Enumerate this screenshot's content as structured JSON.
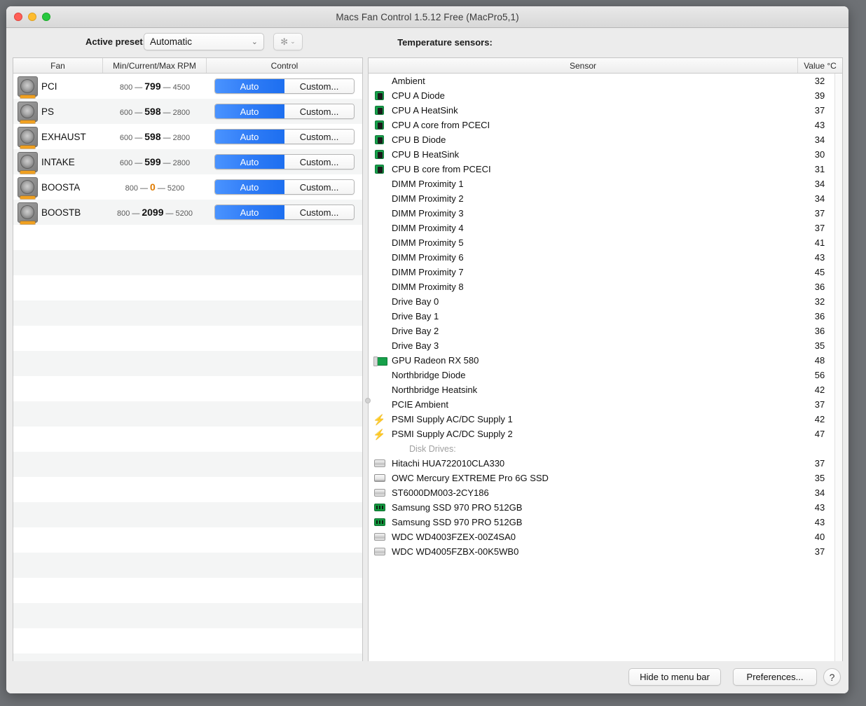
{
  "window": {
    "title": "Macs Fan Control 1.5.12 Free (MacPro5,1)",
    "traffic": {
      "close": "close",
      "minimize": "minimize",
      "maximize": "maximize"
    }
  },
  "toolbar": {
    "preset_label": "Active preset:",
    "preset_value": "Automatic",
    "preset_chevron": "⌄",
    "gear_icon": "gear-icon",
    "gear_glyph": "✻",
    "gear_chevron": "⌄",
    "sensors_heading": "Temperature sensors:"
  },
  "fan_table": {
    "headers": {
      "fan": "Fan",
      "rpm": "Min/Current/Max RPM",
      "control": "Control"
    },
    "control_options": {
      "auto": "Auto",
      "custom": "Custom..."
    },
    "rows": [
      {
        "name": "PCI",
        "min": "800",
        "current": "799",
        "max": "4500",
        "warn": false,
        "control": "auto"
      },
      {
        "name": "PS",
        "min": "600",
        "current": "598",
        "max": "2800",
        "warn": false,
        "control": "auto"
      },
      {
        "name": "EXHAUST",
        "min": "600",
        "current": "598",
        "max": "2800",
        "warn": false,
        "control": "auto"
      },
      {
        "name": "INTAKE",
        "min": "600",
        "current": "599",
        "max": "2800",
        "warn": false,
        "control": "auto"
      },
      {
        "name": "BOOSTA",
        "min": "800",
        "current": "0",
        "max": "5200",
        "warn": true,
        "control": "auto"
      },
      {
        "name": "BOOSTB",
        "min": "800",
        "current": "2099",
        "max": "5200",
        "warn": false,
        "control": "auto"
      }
    ],
    "empty_filler_rows": 18
  },
  "sensor_table": {
    "headers": {
      "sensor": "Sensor",
      "value": "Value °C"
    },
    "rows": [
      {
        "icon": "none",
        "name": "Ambient",
        "value": "32"
      },
      {
        "icon": "chip",
        "name": "CPU A Diode",
        "value": "39"
      },
      {
        "icon": "chip",
        "name": "CPU A HeatSink",
        "value": "37"
      },
      {
        "icon": "chip",
        "name": "CPU A core from PCECI",
        "value": "43"
      },
      {
        "icon": "chip",
        "name": "CPU B Diode",
        "value": "34"
      },
      {
        "icon": "chip",
        "name": "CPU B HeatSink",
        "value": "30"
      },
      {
        "icon": "chip",
        "name": "CPU B core from PCECI",
        "value": "31"
      },
      {
        "icon": "none",
        "name": "DIMM Proximity 1",
        "value": "34"
      },
      {
        "icon": "none",
        "name": "DIMM Proximity 2",
        "value": "34"
      },
      {
        "icon": "none",
        "name": "DIMM Proximity 3",
        "value": "37"
      },
      {
        "icon": "none",
        "name": "DIMM Proximity 4",
        "value": "37"
      },
      {
        "icon": "none",
        "name": "DIMM Proximity 5",
        "value": "41"
      },
      {
        "icon": "none",
        "name": "DIMM Proximity 6",
        "value": "43"
      },
      {
        "icon": "none",
        "name": "DIMM Proximity 7",
        "value": "45"
      },
      {
        "icon": "none",
        "name": "DIMM Proximity 8",
        "value": "36"
      },
      {
        "icon": "none",
        "name": "Drive Bay 0",
        "value": "32"
      },
      {
        "icon": "none",
        "name": "Drive Bay 1",
        "value": "36"
      },
      {
        "icon": "none",
        "name": "Drive Bay 2",
        "value": "36"
      },
      {
        "icon": "none",
        "name": "Drive Bay 3",
        "value": "35"
      },
      {
        "icon": "gpu",
        "name": "GPU Radeon RX 580",
        "value": "48"
      },
      {
        "icon": "none",
        "name": "Northbridge Diode",
        "value": "56"
      },
      {
        "icon": "none",
        "name": "Northbridge Heatsink",
        "value": "42"
      },
      {
        "icon": "none",
        "name": "PCIE Ambient",
        "value": "37"
      },
      {
        "icon": "bolt",
        "name": "PSMI Supply AC/DC Supply 1",
        "value": "42"
      },
      {
        "icon": "bolt",
        "name": "PSMI Supply AC/DC Supply 2",
        "value": "47"
      },
      {
        "icon": "none",
        "name": "Disk Drives:",
        "value": "",
        "group": true
      },
      {
        "icon": "hdd",
        "name": "Hitachi HUA722010CLA330",
        "value": "37"
      },
      {
        "icon": "ssd-w",
        "name": "OWC Mercury EXTREME Pro 6G SSD",
        "value": "35"
      },
      {
        "icon": "hdd",
        "name": "ST6000DM003-2CY186",
        "value": "34"
      },
      {
        "icon": "ssd-g",
        "name": "Samsung SSD 970 PRO 512GB",
        "value": "43"
      },
      {
        "icon": "ssd-g",
        "name": "Samsung SSD 970 PRO 512GB",
        "value": "43"
      },
      {
        "icon": "hdd",
        "name": "WDC WD4003FZEX-00Z4SA0",
        "value": "40"
      },
      {
        "icon": "hdd",
        "name": "WDC WD4005FZBX-00K5WB0",
        "value": "37"
      }
    ],
    "empty_filler_rows": 10
  },
  "bottom": {
    "hide_label": "Hide to menu bar",
    "prefs_label": "Preferences...",
    "help_label": "?"
  }
}
